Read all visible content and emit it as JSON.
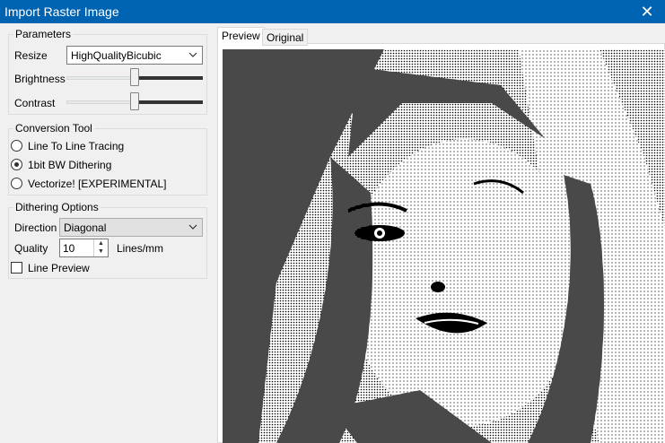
{
  "window": {
    "title": "Import Raster Image",
    "close_glyph": "✕"
  },
  "parameters": {
    "legend": "Parameters",
    "resize_label": "Resize",
    "resize_value": "HighQualityBicubic",
    "brightness_label": "Brightness",
    "brightness_level": 0.51,
    "contrast_label": "Contrast",
    "contrast_level": 0.51
  },
  "conversion": {
    "legend": "Conversion Tool",
    "options": [
      {
        "label": "Line To Line Tracing",
        "selected": false
      },
      {
        "label": "1bit BW Dithering",
        "selected": true
      },
      {
        "label": "Vectorize! [EXPERIMENTAL]",
        "selected": false
      }
    ]
  },
  "dithering": {
    "legend": "Dithering Options",
    "direction_label": "Direction",
    "direction_value": "Diagonal",
    "quality_label": "Quality",
    "quality_value": "10",
    "quality_unit": "Lines/mm",
    "line_preview_label": "Line Preview",
    "line_preview_checked": false
  },
  "tabs": [
    {
      "label": "Preview",
      "active": true
    },
    {
      "label": "Original",
      "active": false
    }
  ],
  "colors": {
    "titlebar": "#0063b1",
    "slider_fill": "#333333"
  }
}
